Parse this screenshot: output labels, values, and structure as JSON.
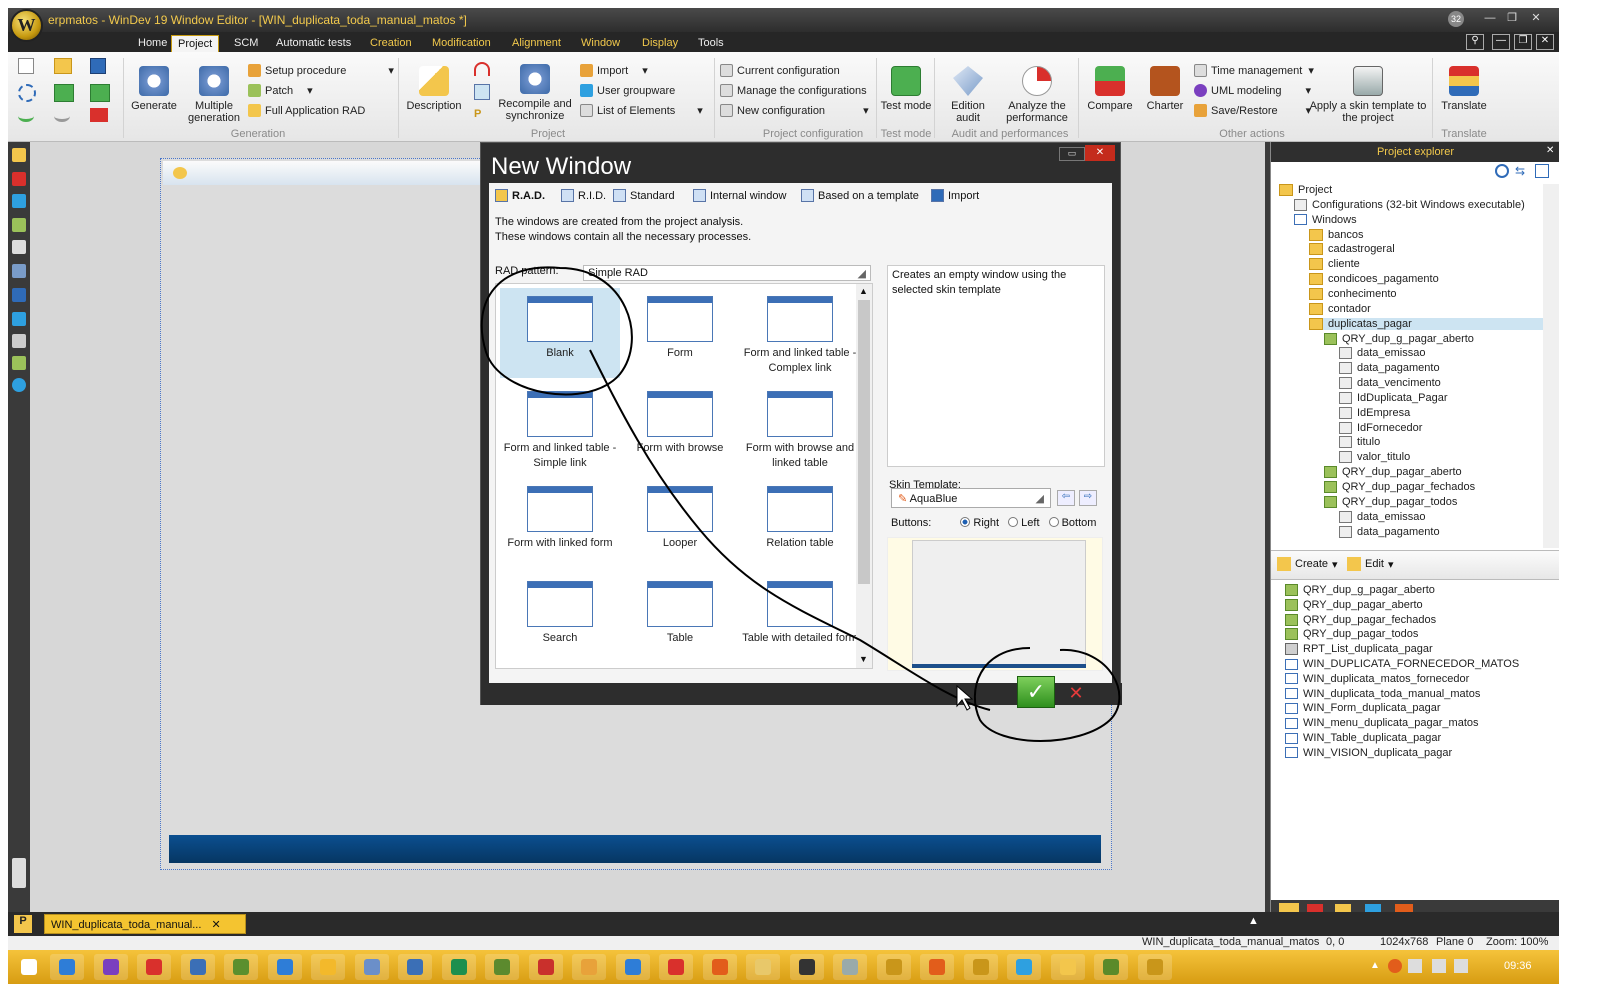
{
  "app": {
    "title": "erpmatos - WinDev 19  Window Editor - [WIN_duplicata_toda_manual_matos *]",
    "logo": "W"
  },
  "menu_tabs": [
    {
      "label": "Home",
      "style": "plain"
    },
    {
      "label": "Project",
      "style": "active"
    },
    {
      "label": "SCM",
      "style": "plain"
    },
    {
      "label": "Automatic tests",
      "style": "plain"
    },
    {
      "label": "Creation",
      "style": "gold"
    },
    {
      "label": "Modification",
      "style": "gold"
    },
    {
      "label": "Alignment",
      "style": "gold"
    },
    {
      "label": "Window",
      "style": "gold"
    },
    {
      "label": "Display",
      "style": "gold"
    },
    {
      "label": "Tools",
      "style": "plain"
    }
  ],
  "ribbon": {
    "generation": {
      "label": "Generation",
      "generate": "Generate",
      "multiple_generation": "Multiple generation",
      "setup_procedure": "Setup procedure",
      "patch": "Patch",
      "full_rad": "Full Application RAD"
    },
    "project": {
      "label": "Project",
      "description": "Description",
      "recompile": "Recompile and synchronize",
      "import": "Import",
      "user_groupware": "User groupware",
      "list_elements": "List of Elements"
    },
    "project_configuration": {
      "label": "Project configuration",
      "current": "Current configuration",
      "manage": "Manage the configurations",
      "new": "New configuration"
    },
    "test_mode": {
      "label": "Test mode",
      "button": "Test mode"
    },
    "audit": {
      "label": "Audit and performances",
      "edition_audit": "Edition audit",
      "analyze": "Analyze the performance"
    },
    "other_actions": {
      "label": "Other actions",
      "compare": "Compare",
      "charter": "Charter",
      "time_mgmt": "Time management",
      "uml": "UML modeling",
      "save_restore": "Save/Restore",
      "apply_skin": "Apply a skin template to the project"
    },
    "translate": {
      "label": "Translate",
      "button": "Translate"
    }
  },
  "dialog": {
    "title": "New Window",
    "tabs": [
      "R.A.D.",
      "R.I.D.",
      "Standard",
      "Internal window",
      "Based on a template",
      "Import"
    ],
    "info_lines": [
      "The windows are created from the project analysis.",
      "These windows contain all the necessary processes."
    ],
    "rad_pattern_label": "RAD pattern:",
    "rad_pattern_value": "Simple RAD",
    "templates": [
      {
        "label": "Blank",
        "selected": true
      },
      {
        "label": "Form",
        "selected": false
      },
      {
        "label": "Form and linked table - Complex link",
        "selected": false
      },
      {
        "label": "Form and linked table - Simple link",
        "selected": false
      },
      {
        "label": "Form with browse",
        "selected": false
      },
      {
        "label": "Form with browse and linked table",
        "selected": false
      },
      {
        "label": "Form with linked form",
        "selected": false
      },
      {
        "label": "Looper",
        "selected": false
      },
      {
        "label": "Relation table",
        "selected": false
      },
      {
        "label": "Search",
        "selected": false
      },
      {
        "label": "Table",
        "selected": false
      },
      {
        "label": "Table with detailed form",
        "selected": false
      }
    ],
    "description": "Creates an empty window using the selected skin template",
    "skin_label": "Skin Template:",
    "skin_value": "AquaBlue",
    "buttons_label": "Buttons:",
    "button_positions": [
      "Right",
      "Left",
      "Bottom"
    ],
    "button_position_selected": "Right"
  },
  "project_explorer": {
    "title": "Project explorer",
    "tree": [
      {
        "label": "Project",
        "level": 0,
        "icon": "project"
      },
      {
        "label": "Configurations (32-bit Windows executable)",
        "level": 1,
        "icon": "config"
      },
      {
        "label": "Windows",
        "level": 1,
        "icon": "window"
      },
      {
        "label": "bancos",
        "level": 2,
        "icon": "folder"
      },
      {
        "label": "cadastrogeral",
        "level": 2,
        "icon": "folder"
      },
      {
        "label": "cliente",
        "level": 2,
        "icon": "folder"
      },
      {
        "label": "condicoes_pagamento",
        "level": 2,
        "icon": "folder"
      },
      {
        "label": "conhecimento",
        "level": 2,
        "icon": "folder"
      },
      {
        "label": "contador",
        "level": 2,
        "icon": "folder"
      },
      {
        "label": "duplicatas_pagar",
        "level": 2,
        "icon": "folder",
        "selected": true
      },
      {
        "label": "QRY_dup_g_pagar_aberto",
        "level": 3,
        "icon": "query"
      },
      {
        "label": "data_emissao",
        "level": 4,
        "icon": "item"
      },
      {
        "label": "data_pagamento",
        "level": 4,
        "icon": "item"
      },
      {
        "label": "data_vencimento",
        "level": 4,
        "icon": "item"
      },
      {
        "label": "IdDuplicata_Pagar",
        "level": 4,
        "icon": "item"
      },
      {
        "label": "IdEmpresa",
        "level": 4,
        "icon": "item"
      },
      {
        "label": "IdFornecedor",
        "level": 4,
        "icon": "item"
      },
      {
        "label": "titulo",
        "level": 4,
        "icon": "item"
      },
      {
        "label": "valor_titulo",
        "level": 4,
        "icon": "item"
      },
      {
        "label": "QRY_dup_pagar_aberto",
        "level": 3,
        "icon": "query"
      },
      {
        "label": "QRY_dup_pagar_fechados",
        "level": 3,
        "icon": "query"
      },
      {
        "label": "QRY_dup_pagar_todos",
        "level": 3,
        "icon": "query"
      },
      {
        "label": "data_emissao",
        "level": 4,
        "icon": "item"
      },
      {
        "label": "data_pagamento",
        "level": 4,
        "icon": "item"
      }
    ],
    "create_label": "Create",
    "edit_label": "Edit",
    "list": [
      {
        "label": "QRY_dup_g_pagar_aberto",
        "icon": "query"
      },
      {
        "label": "QRY_dup_pagar_aberto",
        "icon": "query"
      },
      {
        "label": "QRY_dup_pagar_fechados",
        "icon": "query"
      },
      {
        "label": "QRY_dup_pagar_todos",
        "icon": "query"
      },
      {
        "label": "RPT_List_duplicata_pagar",
        "icon": "report"
      },
      {
        "label": "WIN_DUPLICATA_FORNECEDOR_MATOS",
        "icon": "window"
      },
      {
        "label": "WIN_duplicata_matos_fornecedor",
        "icon": "window"
      },
      {
        "label": "WIN_duplicata_toda_manual_matos",
        "icon": "window"
      },
      {
        "label": "WIN_Form_duplicata_pagar",
        "icon": "window"
      },
      {
        "label": "WIN_menu_duplicata_pagar_matos",
        "icon": "window"
      },
      {
        "label": "WIN_Table_duplicata_pagar",
        "icon": "window"
      },
      {
        "label": "WIN_VISION_duplicata_pagar",
        "icon": "window"
      }
    ]
  },
  "doc_tab": "WIN_duplicata_toda_manual...",
  "status": {
    "window": "WIN_duplicata_toda_manual_matos",
    "coords": "0, 0",
    "resolution": "1024x768",
    "plane": "Plane 0",
    "zoom": "Zoom: 100%"
  },
  "taskbar": {
    "clock": "09:36",
    "colors": [
      "#2e7dd7",
      "#7a3fbf",
      "#d9302c",
      "#3b6fb6",
      "#5b8f2e",
      "#2e7dd7",
      "#f3b92b",
      "#6b8fc9",
      "#3b6fb6",
      "#1d8f4e",
      "#5c8a2e",
      "#c9302c",
      "#e8a23a",
      "#2e7dd7",
      "#d9302c",
      "#e25d1b",
      "#e8c86a",
      "#333",
      "#9aa",
      "#c9961a",
      "#e25d1b",
      "#c9961a",
      "#2ea0e0",
      "#f3c64c",
      "#5a8a2a",
      "#c9961a"
    ]
  },
  "colors": {
    "accent": "#f2c94c",
    "select": "#cde4f2",
    "ok": "#3aa128",
    "cancel": "#e53b3b"
  }
}
